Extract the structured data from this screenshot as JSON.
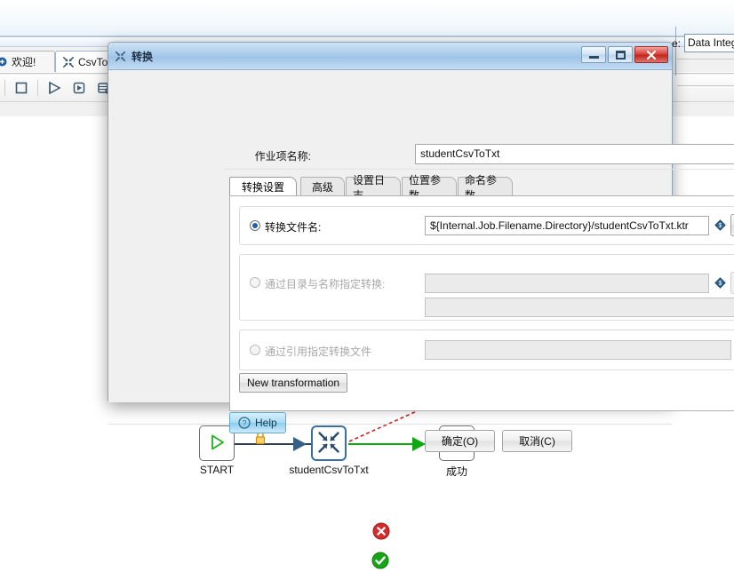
{
  "background_app": {
    "tabs": [
      {
        "label": "欢迎!",
        "icon": "welcome-icon",
        "active": false
      },
      {
        "label": "CsvTo",
        "icon": "transformation-icon",
        "active": true
      }
    ],
    "toolbar_icons": [
      "stop-icon",
      "run-icon",
      "preview-icon",
      "explore-db-icon"
    ],
    "right_label": "e:",
    "right_field_value": "Data Integ"
  },
  "canvas": {
    "nodes": [
      {
        "id": "start",
        "label": "START",
        "icon": "play-triangle-icon"
      },
      {
        "id": "transformation",
        "label": "studentCsvToTxt",
        "icon": "transformation-icon",
        "selected": true
      },
      {
        "id": "success",
        "label": "成功",
        "icon": "checkmark-icon"
      }
    ],
    "hops": [
      {
        "from": "start",
        "to": "transformation",
        "type": "unconditional",
        "badge": "lock-icon",
        "color": "#2c3e50"
      },
      {
        "from": "transformation",
        "to": "success",
        "type": "success",
        "badge": "green-check-icon",
        "color": "#10a810"
      },
      {
        "from": "transformation",
        "to": "offscreen",
        "type": "error",
        "badge": "red-error-icon",
        "color": "#cc2222"
      }
    ]
  },
  "dialog": {
    "title": "转换",
    "title_icon": "transformation-icon",
    "window_buttons": {
      "minimize": "—",
      "maximize": "❐",
      "close": "✕"
    },
    "job_entry_name": {
      "label": "作业项名称:",
      "value": "studentCsvToTxt"
    },
    "tabs": [
      {
        "label": "转换设置",
        "active": true
      },
      {
        "label": "高级",
        "active": false
      },
      {
        "label": "设置日志",
        "active": false
      },
      {
        "label": "位置参数",
        "active": false
      },
      {
        "label": "命名参数",
        "active": false
      }
    ],
    "options": [
      {
        "id": "by-filename",
        "label": "转换文件名:",
        "selected": true,
        "enabled": true,
        "field_value": "${Internal.Job.Filename.Directory}/studentCsvToTxt.ktr",
        "field_placeholder": "",
        "variable_icon": "variable-diamond-icon",
        "browse_icon": "transformation-browse-icon"
      },
      {
        "id": "by-directory-and-name",
        "label": "通过目录与名称指定转换:",
        "selected": false,
        "enabled": false,
        "field_value": "",
        "field_placeholder": "",
        "field_value_2": "",
        "variable_icon": "variable-diamond-icon",
        "browse_icon": "transformation-browse-icon"
      },
      {
        "id": "by-reference",
        "label": "通过引用指定转换文件",
        "selected": false,
        "enabled": false,
        "field_value": "",
        "field_placeholder": "",
        "variable_icon": "variable-diamond-icon",
        "browse_icon": "transformation-browse-icon"
      }
    ],
    "new_transformation_button": "New transformation",
    "help_button": {
      "label": "Help",
      "icon": "question-circle-icon"
    },
    "ok_button": "确定(O)",
    "cancel_button": "取消(C)"
  },
  "colors": {
    "accent": "#3b6ea5",
    "close_red": "#c2251c",
    "success_green": "#10a810",
    "error_red": "#cc2222",
    "help_blue": "#8bcdee",
    "lock_orange": "#e8a020"
  }
}
